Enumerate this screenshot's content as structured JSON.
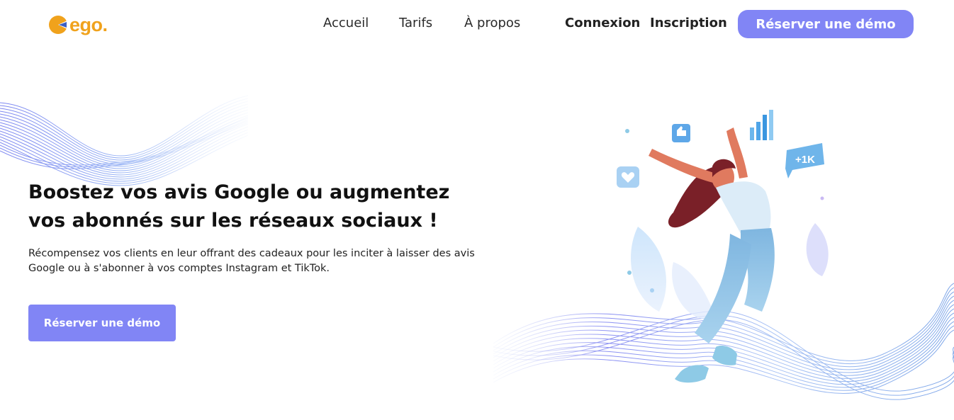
{
  "brand": {
    "name": "ego.",
    "color": "#f0a21c",
    "accent": "#8185f5"
  },
  "nav": {
    "items": [
      "Accueil",
      "Tarifs",
      "À propos"
    ],
    "login": "Connexion",
    "signup": "Inscription",
    "cta": "Réserver une démo"
  },
  "hero": {
    "title_line1": "Boostez vos avis Google ou augmentez",
    "title_line2": "vos abonnés sur les réseaux sociaux !",
    "subtitle": "Récompensez vos clients en leur offrant des cadeaux pour les inciter à laisser des avis Google ou à s'abonner à vos comptes Instagram et TikTok.",
    "cta": "Réserver une démo"
  },
  "illustration": {
    "badge_text": "+1K",
    "icons": [
      "thumbs-up-icon",
      "bar-chart-icon",
      "heart-icon",
      "followers-badge-icon"
    ]
  }
}
